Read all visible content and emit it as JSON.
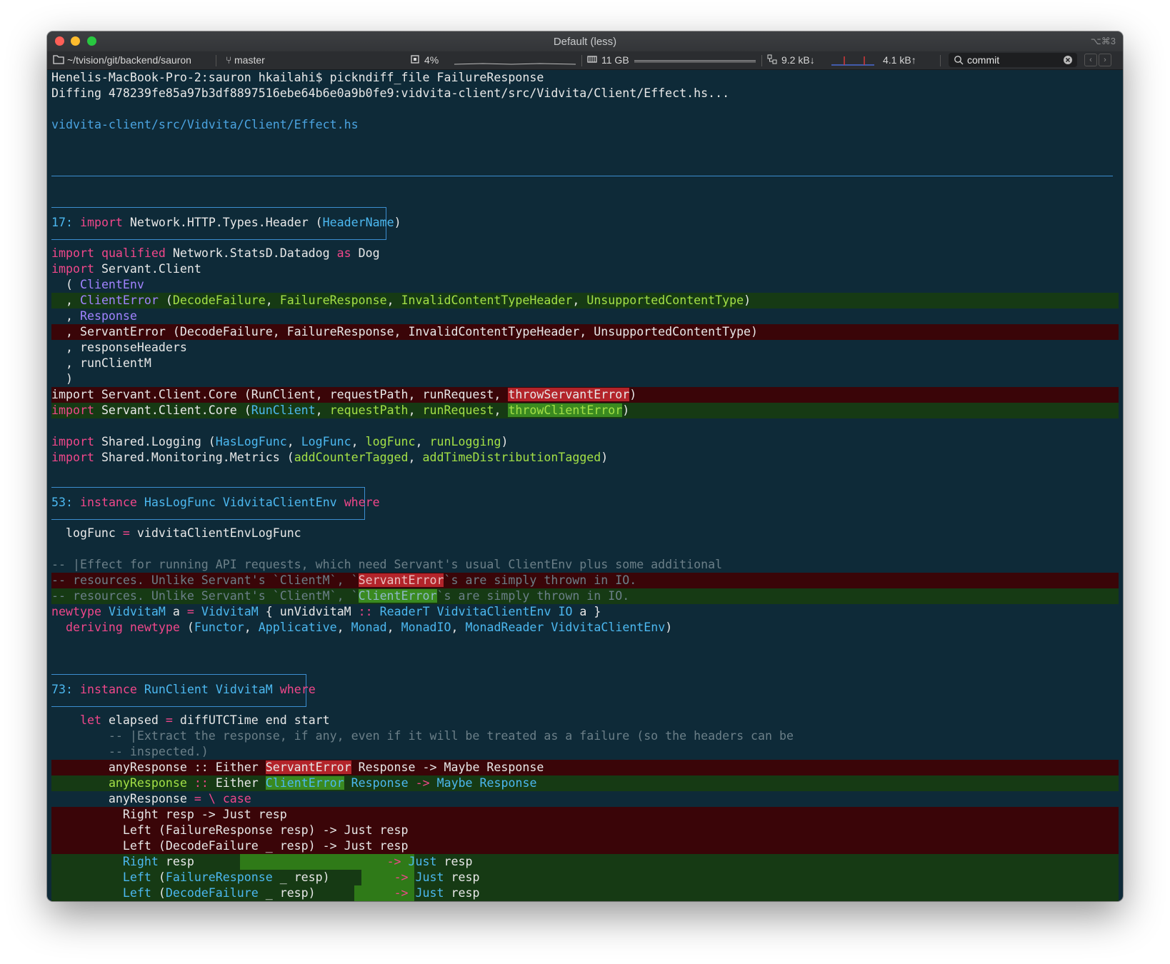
{
  "window": {
    "title": "Default (less)",
    "shortcut": "⌥⌘3"
  },
  "status": {
    "path": "~/tvision/git/backend/sauron",
    "branch": "master",
    "cpu": "4%",
    "mem": "11 GB",
    "net_down": "9.2 kB↓",
    "net_up": "4.1 kB↑",
    "search": "commit"
  },
  "terminal": {
    "prompt": "Henelis-MacBook-Pro-2:sauron hkailahi$ pickndiff_file FailureResponse",
    "diffing": "Diffing 478239fe85a97b3df8897516ebe64b6e0a9b0fe9:vidvita-client/src/Vidvita/Client/Effect.hs...",
    "file": "vidvita-client/src/Vidvita/Client/Effect.hs",
    "hunk1_num": "17:",
    "hunk2_num": "53:",
    "hunk3_num": "73:"
  }
}
